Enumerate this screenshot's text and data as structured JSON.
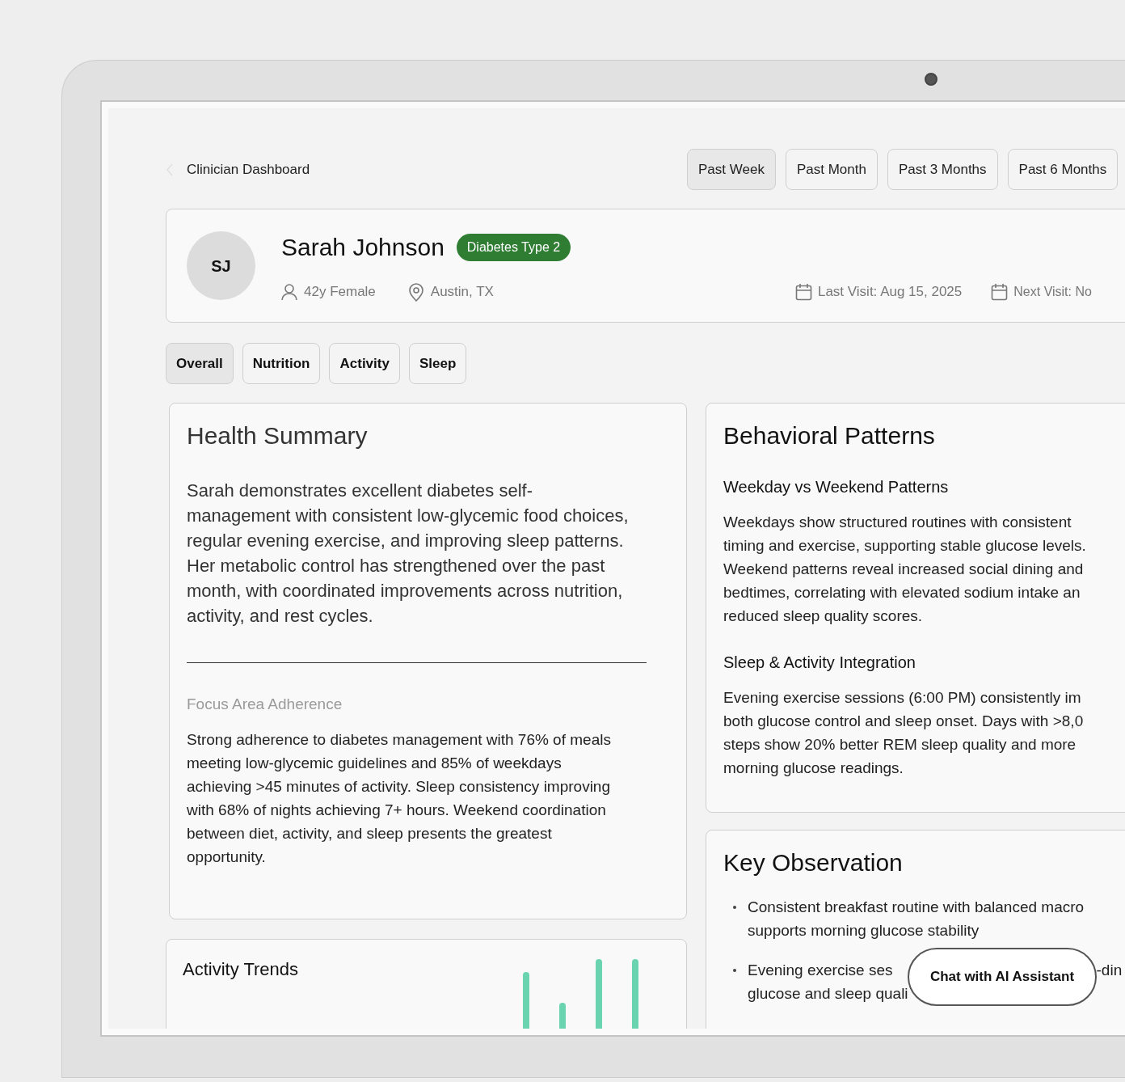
{
  "breadcrumb": {
    "label": "Clinician Dashboard"
  },
  "time_ranges": [
    {
      "label": "Past Week",
      "selected": true
    },
    {
      "label": "Past Month",
      "selected": false
    },
    {
      "label": "Past 3 Months",
      "selected": false
    },
    {
      "label": "Past 6 Months",
      "selected": false
    }
  ],
  "patient": {
    "initials": "SJ",
    "name": "Sarah Johnson",
    "condition": "Diabetes Type 2",
    "demographics": "42y Female",
    "location": "Austin, TX",
    "last_visit": "Last Visit: Aug 15, 2025",
    "next_visit": "Next Visit: No"
  },
  "tabs": [
    {
      "label": "Overall",
      "selected": true
    },
    {
      "label": "Nutrition",
      "selected": false
    },
    {
      "label": "Activity",
      "selected": false
    },
    {
      "label": "Sleep",
      "selected": false
    }
  ],
  "health_summary": {
    "title": "Health Summary",
    "text": "Sarah demonstrates excellent diabetes self-management with consistent low-glycemic food choices, regular evening exercise, and improving sleep patterns. Her metabolic control has strengthened over the past month, with coordinated improvements across nutrition, activity, and rest cycles.",
    "focus_label": "Focus Area Adherence",
    "focus_text": "Strong adherence to diabetes management with 76% of meals meeting low-glycemic guidelines and 85% of weekdays achieving >45 minutes of activity. Sleep consistency improving with 68% of nights achieving 7+ hours. Weekend coordination between diet, activity, and sleep presents the greatest opportunity."
  },
  "activity_trends": {
    "title": "Activity Trends"
  },
  "behavioral_patterns": {
    "title": "Behavioral Patterns",
    "sections": [
      {
        "heading": "Weekday vs Weekend Patterns",
        "lines": [
          "Weekdays show structured routines with consistent",
          "timing and exercise, supporting stable glucose levels.",
          "Weekend patterns reveal increased social dining and",
          "bedtimes, correlating with elevated sodium intake an",
          "reduced sleep quality scores."
        ]
      },
      {
        "heading": "Sleep & Activity Integration",
        "lines": [
          "Evening exercise sessions (6:00 PM) consistently im",
          "both glucose control and sleep onset. Days with >8,0",
          "steps show 20% better REM sleep quality and more",
          "morning glucose readings."
        ]
      }
    ]
  },
  "key_observation": {
    "title": "Key Observation",
    "bullets": [
      {
        "lines": [
          [
            "Consistent breakfast routine with balanced macro"
          ],
          [
            "supports morning glucose stability"
          ]
        ]
      },
      {
        "lines": [
          [
            "Evening exercise ses",
            "-din"
          ],
          [
            "glucose and sleep quali"
          ]
        ]
      }
    ]
  },
  "chat_button": {
    "label": "Chat with AI Assistant"
  }
}
